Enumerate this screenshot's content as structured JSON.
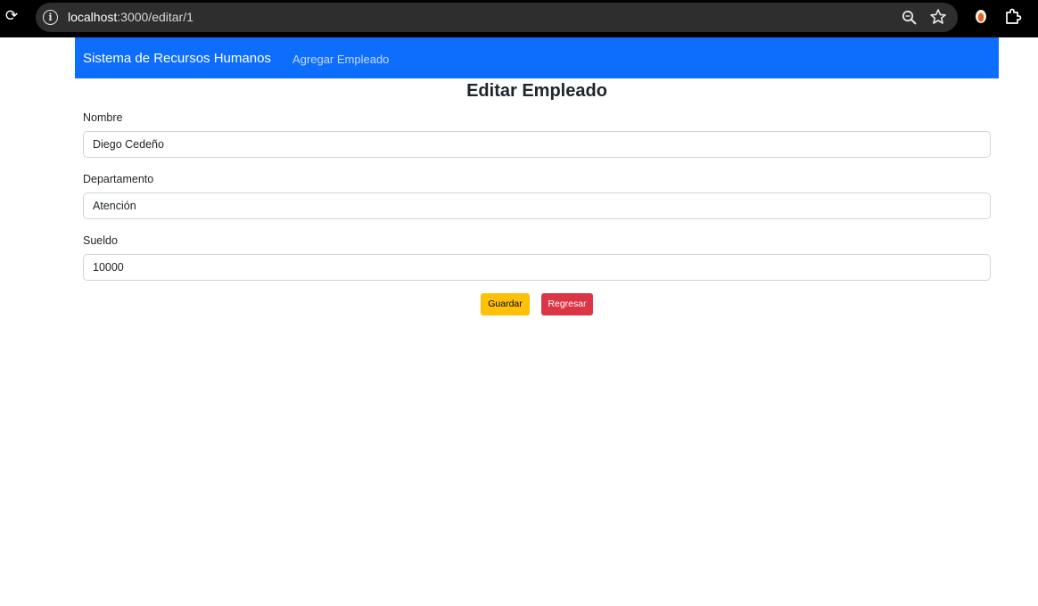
{
  "browser": {
    "url_host": "localhost",
    "url_path": ":3000/editar/1"
  },
  "navbar": {
    "brand": "Sistema de Recursos Humanos",
    "link_add": "Agregar Empleado"
  },
  "form": {
    "title": "Editar Empleado",
    "fields": [
      {
        "label": "Nombre",
        "value": "Diego Cedeño"
      },
      {
        "label": "Departamento",
        "value": "Atención"
      },
      {
        "label": "Sueldo",
        "value": "10000"
      }
    ],
    "save_label": "Guardar",
    "back_label": "Regresar"
  },
  "colors": {
    "navbar": "#0d6efd",
    "save_button": "#ffc107",
    "back_button": "#dc3545"
  },
  "icons": [
    "reload-icon",
    "site-info-icon",
    "zoom-icon",
    "bookmark-star-icon",
    "extension-icon",
    "extensions-puzzle-icon"
  ]
}
